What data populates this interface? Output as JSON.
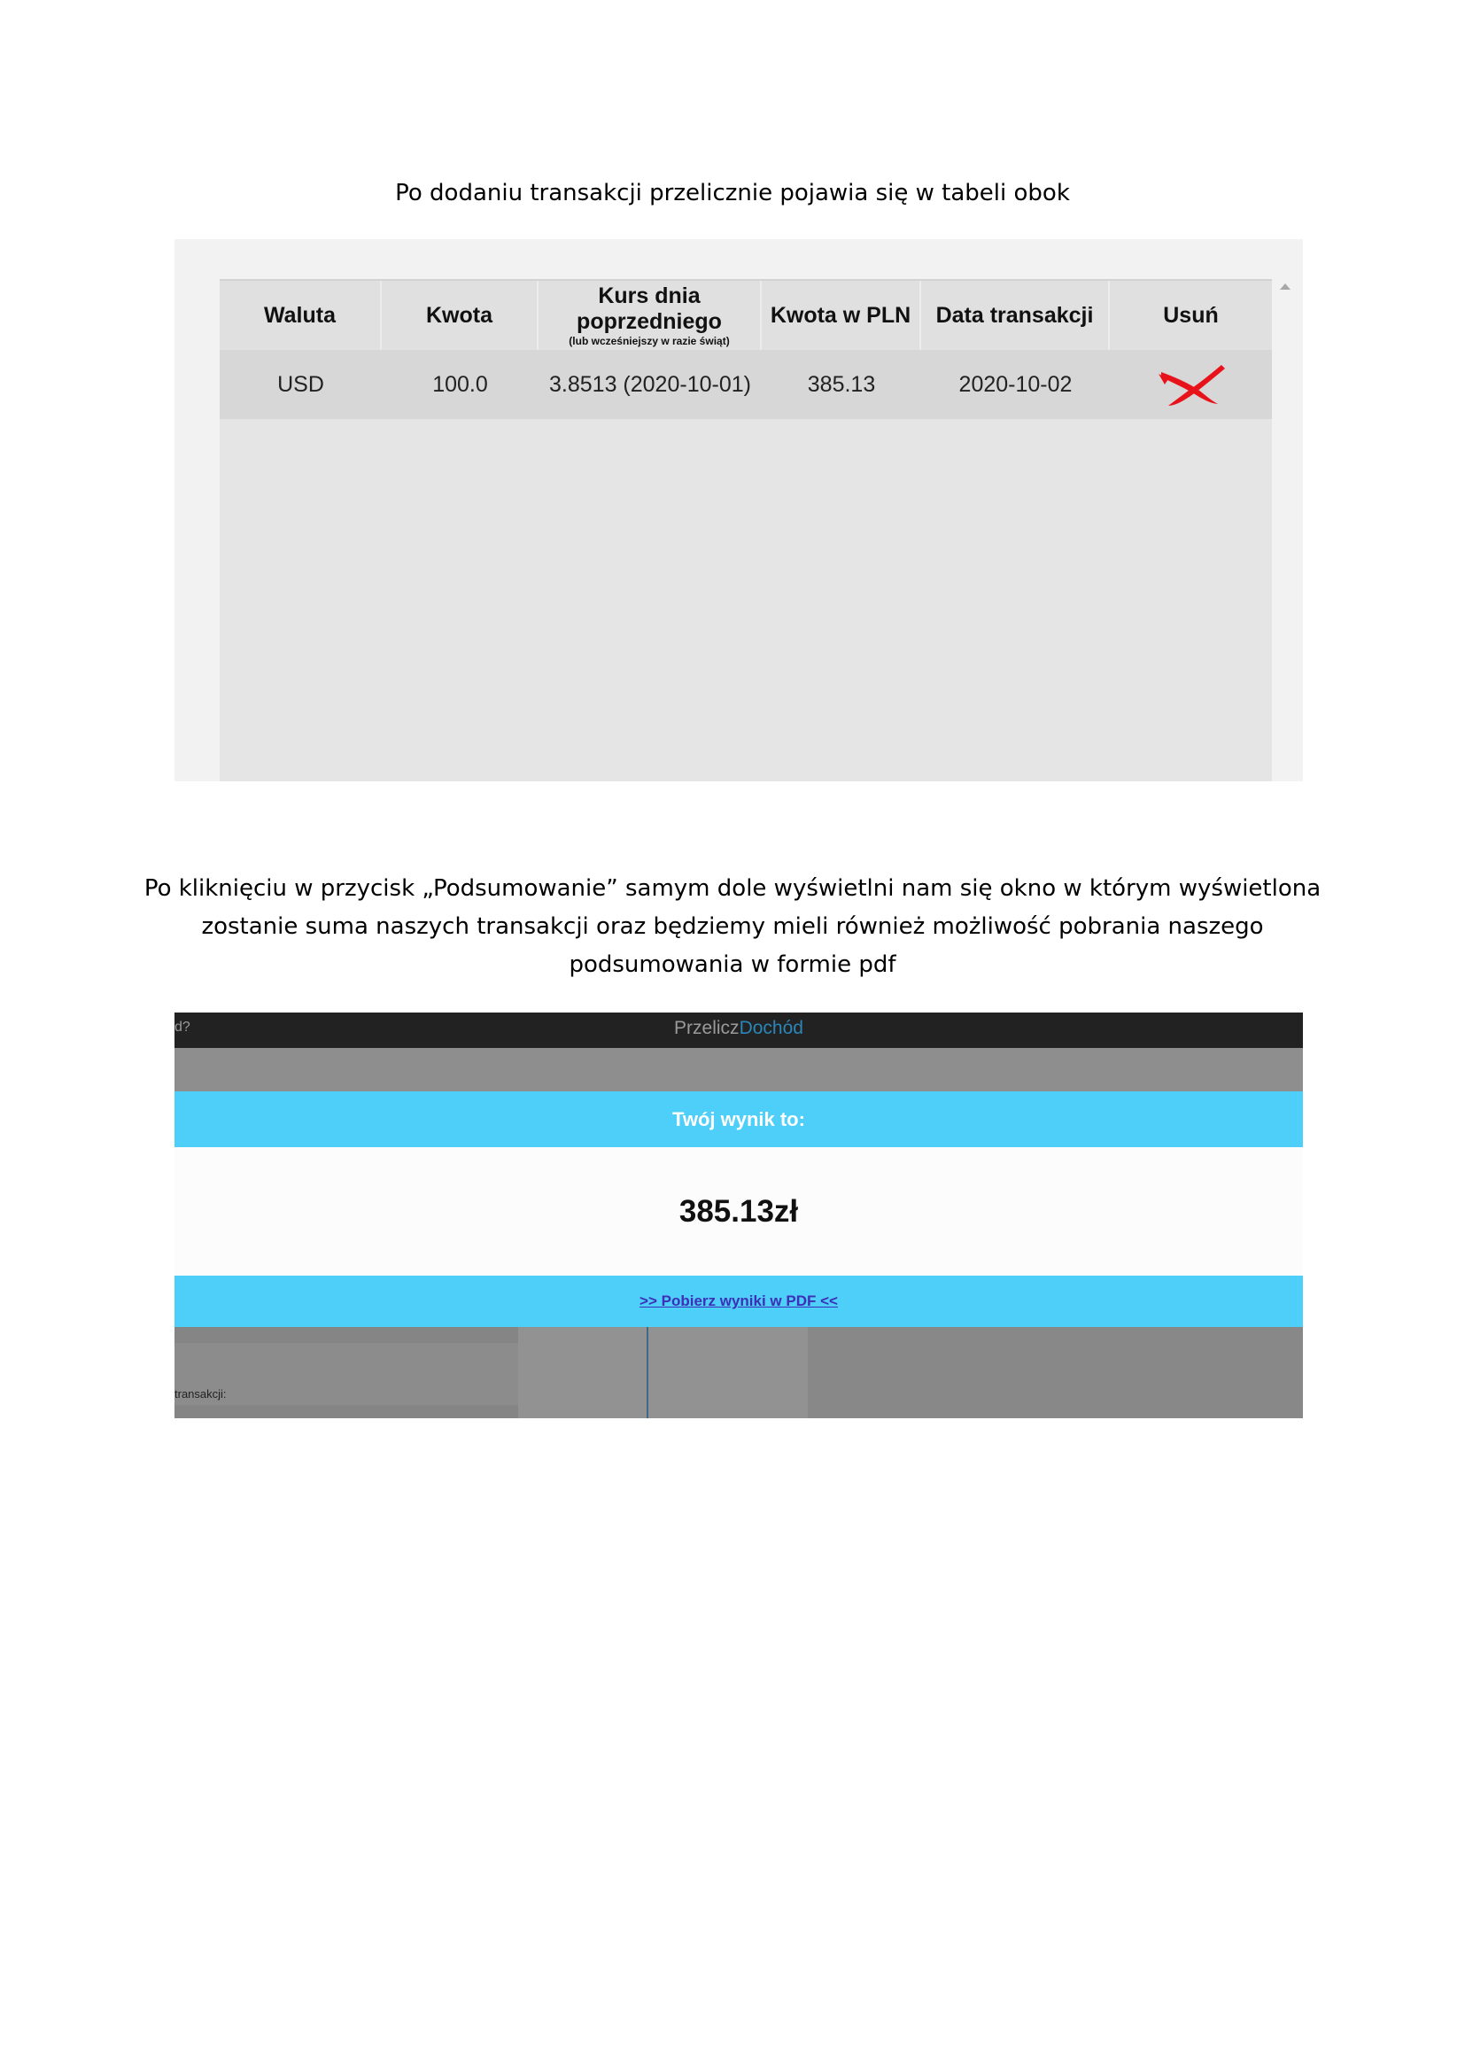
{
  "intro": "Po dodaniu transakcji przelicznie pojawia się w tabeli obok",
  "table": {
    "headers": {
      "currency": "Waluta",
      "amount": "Kwota",
      "rate_main": "Kurs dnia poprzedniego",
      "rate_note": "(lub wcześniejszy w razie świąt)",
      "amount_pln": "Kwota w PLN",
      "date": "Data transakcji",
      "delete": "Usuń"
    },
    "rows": [
      {
        "currency": "USD",
        "amount": "100.0",
        "rate": "3.8513 (2020-10-01)",
        "amount_pln": "385.13",
        "date": "2020-10-02",
        "delete_icon": "red-x-icon"
      }
    ],
    "colors": {
      "delete_icon": "#e8121a"
    }
  },
  "summary_text": "Po kliknięciu w przycisk „Podsumowanie” samym dole wyświetlni nam się okno w którym wyświetlona zostanie suma naszych transakcji  oraz będziemy mieli również możliwość pobrania naszego podsumowania w formie pdf",
  "app": {
    "topbar_left": "d?",
    "brand_part1": "Przelicz",
    "brand_part2": "Dochód",
    "result_title": "Twój wynik to:",
    "result_value": "385.13zł",
    "pdf_link": ">> Pobierz wyniki w PDF <<",
    "lower_label": "transakcji:",
    "colors": {
      "accent": "#4dcffa",
      "brand_highlight": "#2a86b8",
      "link": "#3d2fb8",
      "topbar": "#222222"
    }
  }
}
